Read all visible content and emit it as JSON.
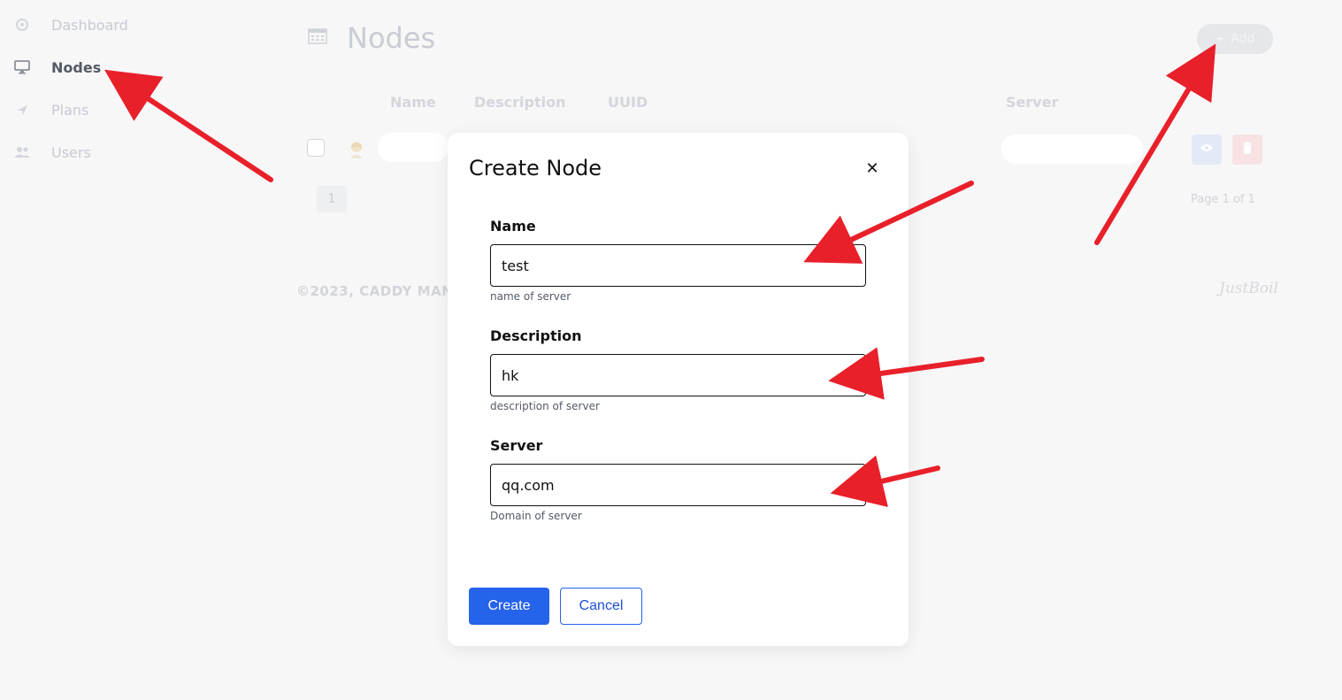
{
  "sidebar": {
    "items": [
      {
        "label": "Dashboard",
        "icon": "dashboard-icon"
      },
      {
        "label": "Nodes",
        "icon": "monitor-icon",
        "active": true
      },
      {
        "label": "Plans",
        "icon": "plane-icon"
      },
      {
        "label": "Users",
        "icon": "users-icon"
      }
    ]
  },
  "header": {
    "title": "Nodes",
    "add_label": "Add",
    "add_icon": "plus-icon"
  },
  "table": {
    "columns": [
      "Name",
      "Description",
      "UUID",
      "Server"
    ]
  },
  "pagination": {
    "current": "1",
    "info": "Page 1 of 1"
  },
  "footer": {
    "copyright": "©2023, CADDY MAN",
    "brand": "JustBoil"
  },
  "modal": {
    "title": "Create Node",
    "close_icon": "close-icon",
    "fields": [
      {
        "label": "Name",
        "value": "test",
        "help": "name of server"
      },
      {
        "label": "Description",
        "value": "hk",
        "help": "description of server"
      },
      {
        "label": "Server",
        "value": "qq.com",
        "help": "Domain of server"
      }
    ],
    "create_label": "Create",
    "cancel_label": "Cancel"
  },
  "colors": {
    "primary": "#2563eb",
    "annotation_arrow": "#e8202a"
  }
}
